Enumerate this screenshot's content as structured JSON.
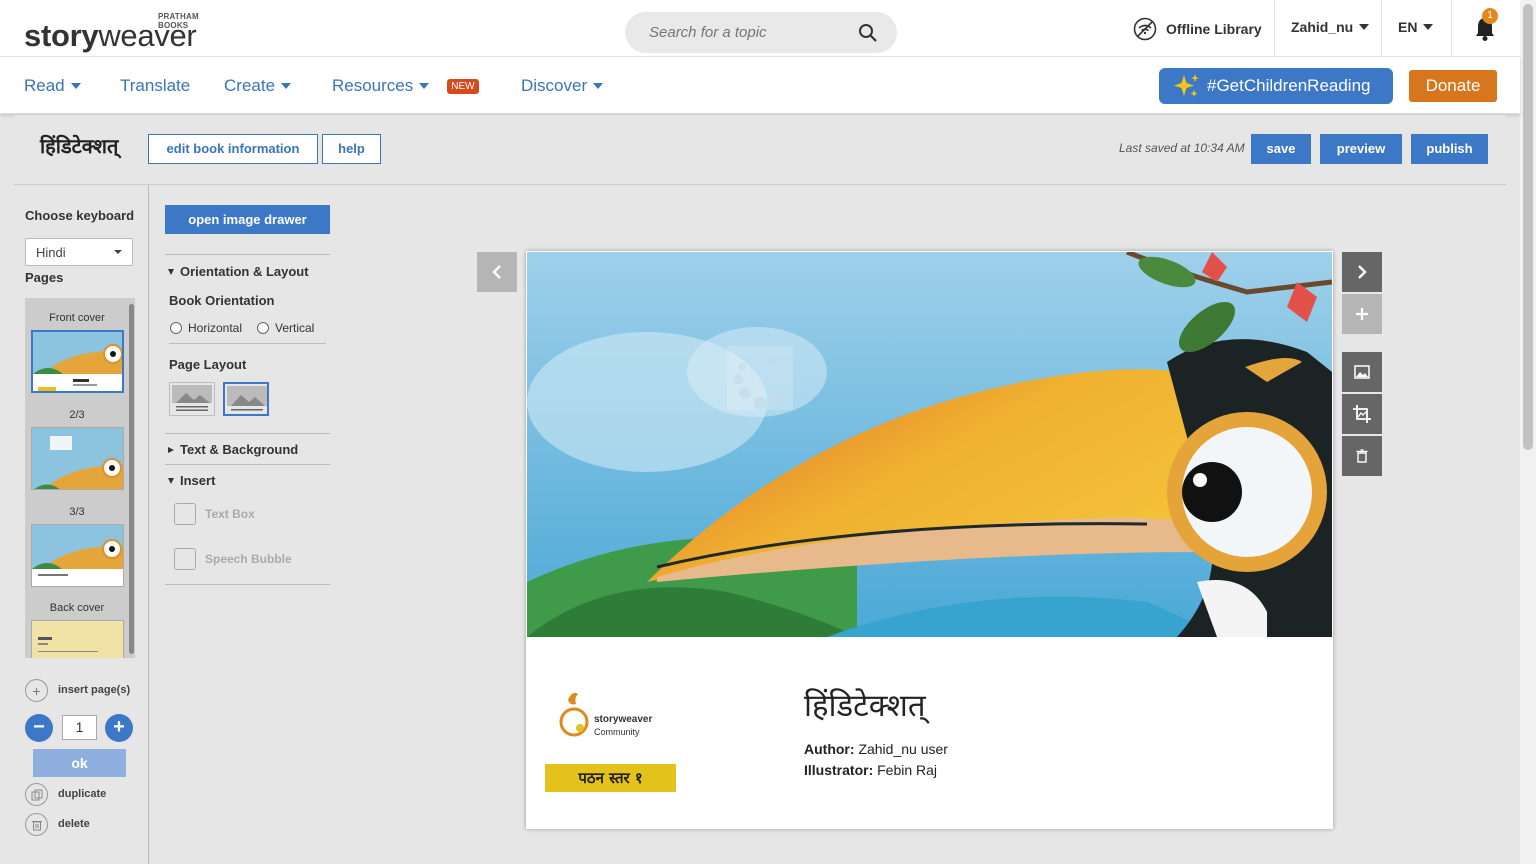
{
  "header": {
    "logo": {
      "publisher": "PRATHAM BOOKS",
      "wordmark_bold": "story",
      "wordmark_light": "weaver"
    },
    "search": {
      "placeholder": "Search for a topic",
      "icon": "search-icon"
    },
    "offline_library": "Offline Library",
    "user": "Zahid_nu",
    "language": "EN",
    "notifications": {
      "count": "1",
      "icon": "bell-icon"
    }
  },
  "nav": {
    "read": "Read",
    "translate": "Translate",
    "create": "Create",
    "resources": "Resources",
    "new_badge": "NEW",
    "discover": "Discover",
    "campaign": "#GetChildrenReading",
    "donate": "Donate"
  },
  "editor_toolbar": {
    "book_title": "हिंडिटेक्शत्",
    "edit_info": "edit book information",
    "help": "help",
    "last_saved": "Last saved at 10:34 AM",
    "save": "save",
    "preview": "preview",
    "publish": "publish"
  },
  "pages_panel": {
    "choose_keyboard": "Choose keyboard",
    "keyboard": "Hindi",
    "pages_label": "Pages",
    "pages": [
      {
        "label": "Front cover",
        "selected": true
      },
      {
        "label": "2/3",
        "selected": false
      },
      {
        "label": "3/3",
        "selected": false
      },
      {
        "label": "Back cover",
        "selected": false
      }
    ],
    "insert_pages": "insert page(s)",
    "page_count": "1",
    "ok": "ok",
    "duplicate": "duplicate",
    "delete": "delete"
  },
  "tools_panel": {
    "open_image_drawer": "open image drawer",
    "orientation_layout": "Orientation & Layout",
    "book_orientation": "Book Orientation",
    "horizontal": "Horizontal",
    "vertical": "Vertical",
    "page_layout": "Page Layout",
    "text_background": "Text & Background",
    "insert": "Insert",
    "text_box": "Text Box",
    "speech_bubble": "Speech Bubble"
  },
  "cover": {
    "title": "हिंडिटेक्शत्",
    "author_label": "Author:",
    "author": "Zahid_nu user",
    "illustrator_label": "Illustrator:",
    "illustrator": "Febin Raj",
    "level": "पठन स्तर १",
    "community_logo_line1": "storyweaver",
    "community_logo_line2": "Community"
  },
  "colors": {
    "accent": "#3d78c7",
    "donate": "#d7761c",
    "new_badge": "#d64a1d",
    "level_badge": "#e2c21b"
  }
}
